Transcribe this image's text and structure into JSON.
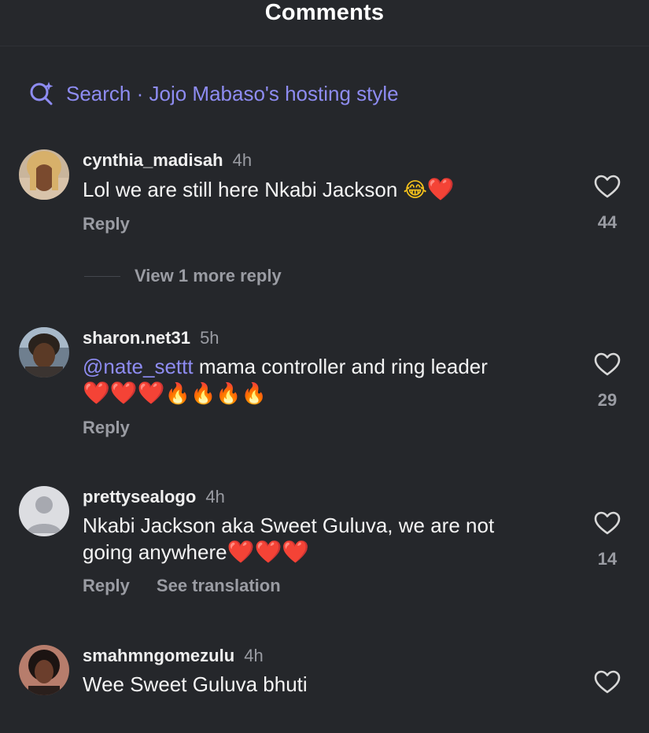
{
  "header": {
    "title": "Comments"
  },
  "search": {
    "text": "Search · Jojo Mabaso's hosting style"
  },
  "comments": [
    {
      "username": "cynthia_madisah",
      "time": "4h",
      "text": "Lol we are still here Nkabi Jackson",
      "emojis": [
        "😂",
        "❤️"
      ],
      "reply_label": "Reply",
      "likes": "44",
      "more_replies": "View 1 more reply"
    },
    {
      "username": "sharon.net31",
      "time": "5h",
      "mention": "@nate_settt",
      "text": "mama controller and ring leader",
      "emojis": [
        "❤️",
        "❤️",
        "❤️",
        "🔥",
        "🔥",
        "🔥",
        "🔥"
      ],
      "reply_label": "Reply",
      "likes": "29"
    },
    {
      "username": "prettysealogo",
      "time": "4h",
      "text_line1": "Nkabi Jackson aka Sweet Guluva, we are not",
      "text_line2": "going anywhere",
      "emojis": [
        "❤️",
        "❤️",
        "❤️"
      ],
      "reply_label": "Reply",
      "translate_label": "See translation",
      "likes": "14"
    },
    {
      "username": "smahmngomezulu",
      "time": "4h",
      "text": "Wee Sweet Guluva bhuti"
    }
  ],
  "colors": {
    "background": "#25272b",
    "accent": "#8e8cf2",
    "muted": "#9a9ca3",
    "heart": "#e0242c"
  }
}
